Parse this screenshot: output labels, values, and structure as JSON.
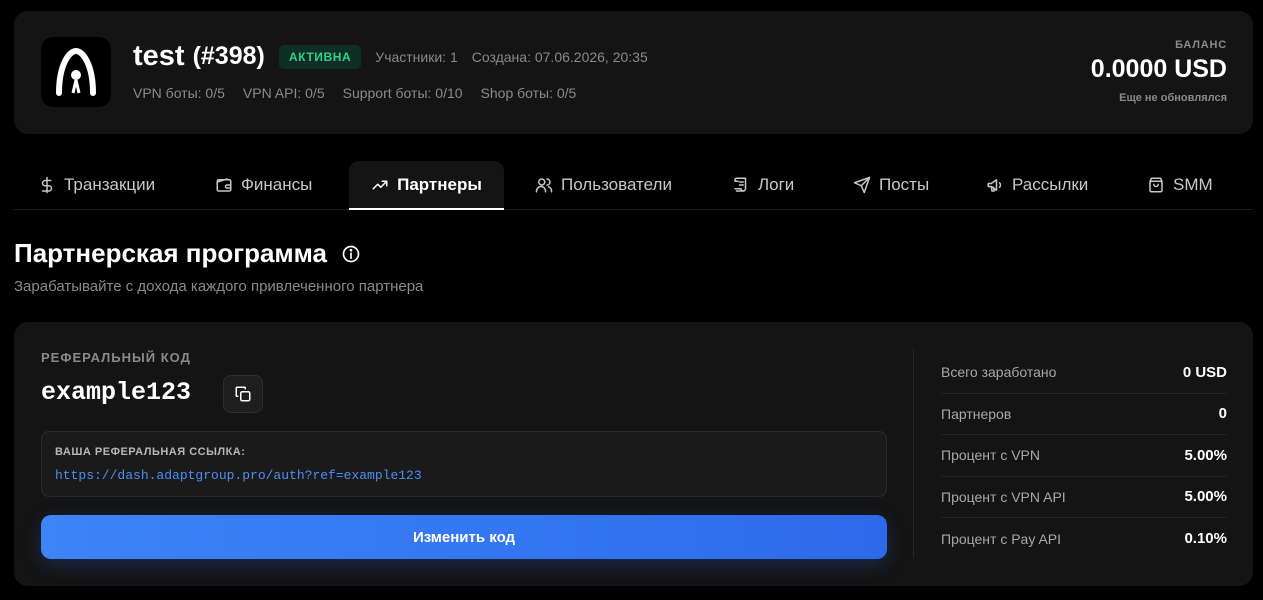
{
  "header": {
    "project_name": "test",
    "project_id": "(#398)",
    "status": "АКТИВНА",
    "participants": "Участники: 1",
    "created": "Создана: 07.06.2026, 20:35",
    "bot_limits": [
      "VPN боты: 0/5",
      "VPN API: 0/5",
      "Support боты: 0/10",
      "Shop боты: 0/5"
    ],
    "balance_label": "БАЛАНС",
    "balance_value": "0.0000 USD",
    "balance_sub": "Еще не обновлялся"
  },
  "tabs": [
    {
      "label": "Транзакции",
      "icon": "dollar-icon"
    },
    {
      "label": "Финансы",
      "icon": "wallet-icon"
    },
    {
      "label": "Партнеры",
      "icon": "trending-up-icon",
      "active": true
    },
    {
      "label": "Пользователи",
      "icon": "users-icon"
    },
    {
      "label": "Логи",
      "icon": "scroll-icon"
    },
    {
      "label": "Посты",
      "icon": "send-icon"
    },
    {
      "label": "Рассылки",
      "icon": "megaphone-icon"
    },
    {
      "label": "SMM",
      "icon": "shopping-bag-icon"
    }
  ],
  "section": {
    "title": "Партнерская программа",
    "subtitle": "Зарабатывайте с дохода каждого привлеченного партнера"
  },
  "referral": {
    "label": "РЕФЕРАЛЬНЫЙ КОД",
    "code": "example123",
    "link_label": "ВАША РЕФЕРАЛЬНАЯ ССЫЛКА:",
    "link_url": "https://dash.adaptgroup.pro/auth?ref=example123",
    "change_button": "Изменить код"
  },
  "stats": [
    {
      "label": "Всего заработано",
      "value": "0 USD"
    },
    {
      "label": "Партнеров",
      "value": "0"
    },
    {
      "label": "Процент с VPN",
      "value": "5.00%"
    },
    {
      "label": "Процент с VPN API",
      "value": "5.00%"
    },
    {
      "label": "Процент с Pay API",
      "value": "0.10%"
    }
  ],
  "colors": {
    "accent": "#3d84f7",
    "status_green": "#2fd18b",
    "card_bg": "#141414",
    "link": "#4d8ef5"
  }
}
